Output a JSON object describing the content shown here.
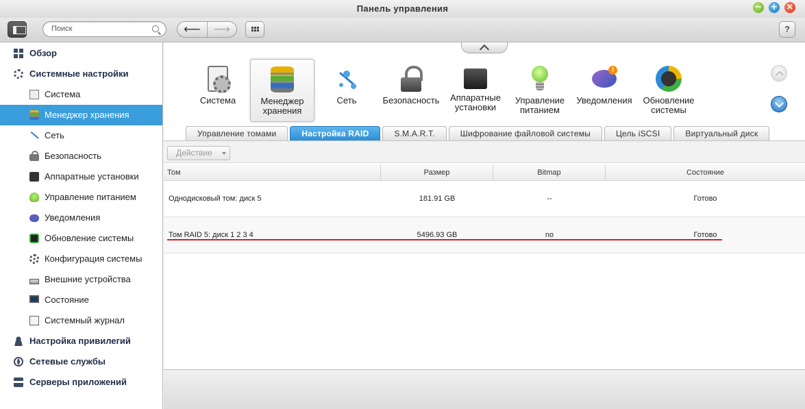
{
  "window": {
    "title": "Панель управления",
    "buttons": [
      "minimize-button",
      "maximize-button",
      "close-button"
    ]
  },
  "toolbar": {
    "search_placeholder": "Поиск",
    "back_glyph": "⟵",
    "forward_glyph": "⟶",
    "help_label": "?"
  },
  "sidebar": {
    "items": [
      {
        "label": "Обзор",
        "level": "top",
        "icon": "overview-icon"
      },
      {
        "label": "Системные настройки",
        "level": "top",
        "icon": "gear-icon"
      },
      {
        "label": "Система",
        "level": "sub",
        "icon": "system-doc-icon"
      },
      {
        "label": "Менеджер хранения",
        "level": "sub",
        "icon": "storage-disk-icon",
        "active": true
      },
      {
        "label": "Сеть",
        "level": "sub",
        "icon": "network-icon"
      },
      {
        "label": "Безопасность",
        "level": "sub",
        "icon": "lock-icon"
      },
      {
        "label": "Аппаратные установки",
        "level": "sub",
        "icon": "hardware-icon"
      },
      {
        "label": "Управление питанием",
        "level": "sub",
        "icon": "bulb-icon"
      },
      {
        "label": "Уведомления",
        "level": "sub",
        "icon": "notification-icon"
      },
      {
        "label": "Обновление системы",
        "level": "sub",
        "icon": "update-icon"
      },
      {
        "label": "Конфигурация системы",
        "level": "sub",
        "icon": "config-gear-icon"
      },
      {
        "label": "Внешние устройства",
        "level": "sub",
        "icon": "external-device-icon"
      },
      {
        "label": "Состояние",
        "level": "sub",
        "icon": "monitor-icon"
      },
      {
        "label": "Системный журнал",
        "level": "sub",
        "icon": "log-icon"
      },
      {
        "label": "Настройка привилегий",
        "level": "top",
        "icon": "user-icon"
      },
      {
        "label": "Сетевые службы",
        "level": "top",
        "icon": "globe-icon"
      },
      {
        "label": "Серверы приложений",
        "level": "top",
        "icon": "server-icon"
      }
    ]
  },
  "app_icons": [
    {
      "line1": "Система",
      "line2": "",
      "icon": "system-icon"
    },
    {
      "line1": "Менеджер",
      "line2": "хранения",
      "icon": "storage-manager-icon",
      "active": true
    },
    {
      "line1": "Сеть",
      "line2": "",
      "icon": "network-icon"
    },
    {
      "line1": "Безопасность",
      "line2": "",
      "icon": "security-lock-icon"
    },
    {
      "line1": "Аппаратные",
      "line2": "установки",
      "icon": "hardware-icon"
    },
    {
      "line1": "Управление",
      "line2": "питанием",
      "icon": "power-bulb-icon"
    },
    {
      "line1": "Уведомления",
      "line2": "",
      "icon": "notification-icon"
    },
    {
      "line1": "Обновление",
      "line2": "системы",
      "icon": "firmware-update-icon"
    }
  ],
  "subtabs": [
    {
      "label": "Управление томами"
    },
    {
      "label": "Настройка RAID",
      "active": true
    },
    {
      "label": "S.M.A.R.T."
    },
    {
      "label": "Шифрование файловой системы"
    },
    {
      "label": "Цель iSCSI"
    },
    {
      "label": "Виртуальный диск"
    }
  ],
  "action": {
    "label": "Действие"
  },
  "table": {
    "headers": [
      "Том",
      "Размер",
      "Bitmap",
      "Состояние"
    ],
    "rows": [
      [
        "Однодисковый том: диск 5",
        "181.91 GB",
        "--",
        "Готово"
      ],
      [
        "Том RAID 5: диск 1 2 3 4",
        "5496.93 GB",
        "no",
        "Готово"
      ]
    ]
  },
  "colors": {
    "accent": "#3a9ddc",
    "highlight_underline": "#d4202e"
  }
}
